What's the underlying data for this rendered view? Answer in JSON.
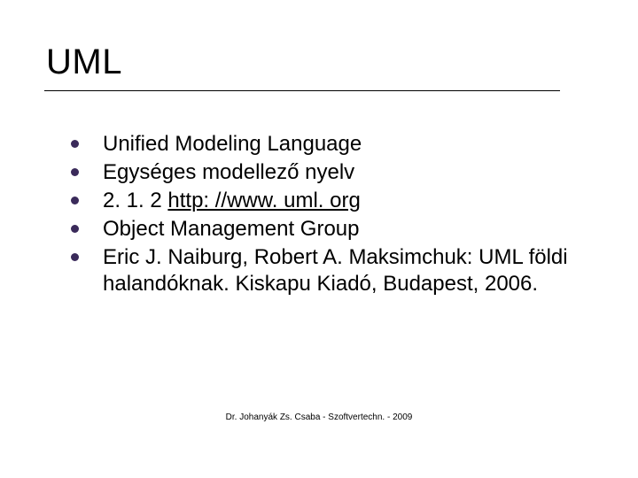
{
  "title": "UML",
  "bullets": [
    {
      "text": "Unified Modeling Language"
    },
    {
      "text": "Egységes modellező nyelv"
    },
    {
      "prefix": "2. 1. 2 ",
      "link": "http: //www. uml. org"
    },
    {
      "text": "Object Management Group"
    },
    {
      "text": "Eric J. Naiburg, Robert A. Maksimchuk: UML földi halandóknak. Kiskapu Kiadó, Budapest, 2006."
    }
  ],
  "footer": "Dr. Johanyák Zs. Csaba - Szoftvertechn. - 2009"
}
